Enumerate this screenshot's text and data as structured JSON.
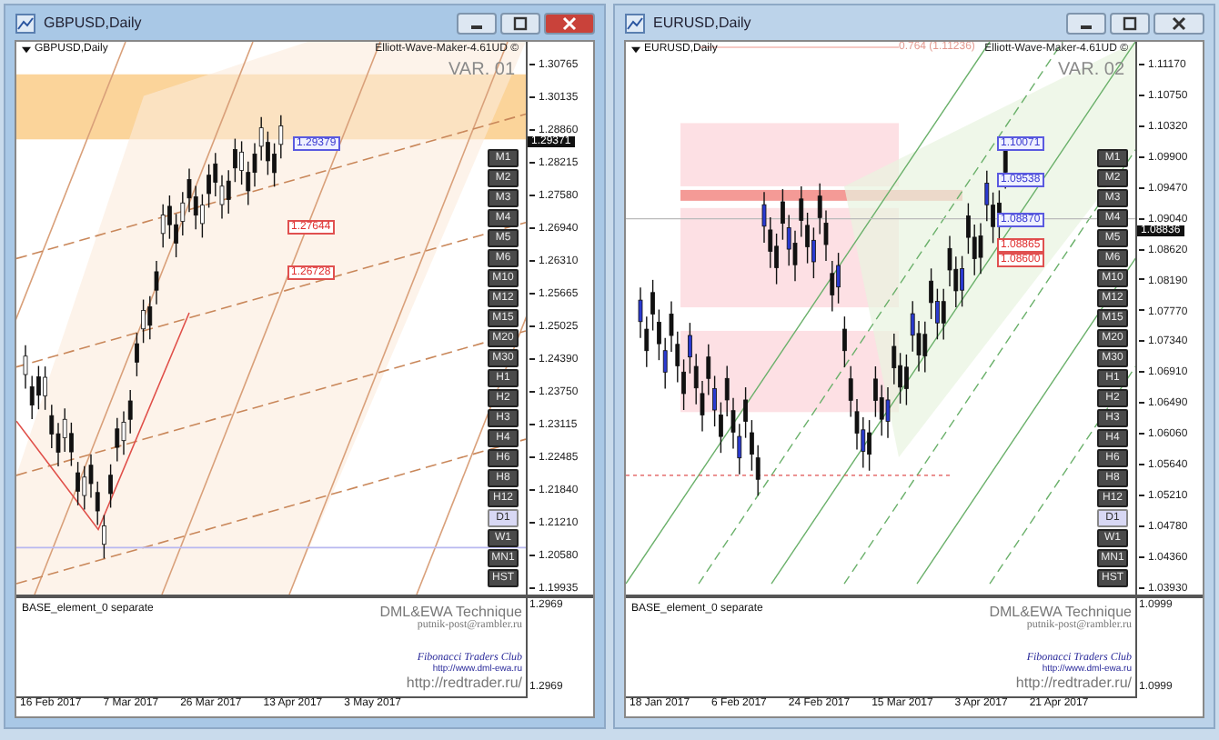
{
  "windows": [
    {
      "title": "GBPUSD,Daily",
      "active": true,
      "chart": {
        "symbol_label": "GBPUSD,Daily",
        "indicator": "Elliott-Wave-Maker-4.61UD ©",
        "variant": "VAR. 01",
        "price_labels": [
          {
            "text": "1.29379",
            "kind": "up"
          },
          {
            "text": "1.27644",
            "kind": "down"
          },
          {
            "text": "1.26728",
            "kind": "down"
          }
        ],
        "current_price": "1.29371",
        "price_ticks": [
          "1.30765",
          "1.30135",
          "1.28860",
          "1.28215",
          "1.27580",
          "1.26940",
          "1.26310",
          "1.25665",
          "1.25025",
          "1.24390",
          "1.23750",
          "1.23115",
          "1.22485",
          "1.21840",
          "1.21210",
          "1.20580",
          "1.19935"
        ],
        "timeframes": [
          {
            "label": "M1",
            "selected": false
          },
          {
            "label": "M2",
            "selected": false
          },
          {
            "label": "M3",
            "selected": false
          },
          {
            "label": "M4",
            "selected": false
          },
          {
            "label": "M5",
            "selected": false
          },
          {
            "label": "M6",
            "selected": false
          },
          {
            "label": "M10",
            "selected": false
          },
          {
            "label": "M12",
            "selected": false
          },
          {
            "label": "M15",
            "selected": false
          },
          {
            "label": "M20",
            "selected": false
          },
          {
            "label": "M30",
            "selected": false
          },
          {
            "label": "H1",
            "selected": false
          },
          {
            "label": "H2",
            "selected": false
          },
          {
            "label": "H3",
            "selected": false
          },
          {
            "label": "H4",
            "selected": false
          },
          {
            "label": "H6",
            "selected": false
          },
          {
            "label": "H8",
            "selected": false
          },
          {
            "label": "H12",
            "selected": false
          },
          {
            "label": "D1",
            "selected": true
          },
          {
            "label": "W1",
            "selected": false
          },
          {
            "label": "MN1",
            "selected": false
          },
          {
            "label": "HST",
            "selected": false
          }
        ]
      },
      "subpanel": {
        "label": "BASE_element_0 separate",
        "credits": [
          "DML&EWA Technique",
          "putnik-post@rambler.ru"
        ],
        "club": "Fibonacci Traders Club",
        "club_url": "http://www.dml-ewa.ru",
        "site": "http://redtrader.ru/",
        "ticks": [
          "1.2969",
          "1.2969"
        ]
      },
      "dates": [
        "16 Feb 2017",
        "7 Mar 2017",
        "26 Mar 2017",
        "13 Apr 2017",
        "3 May 2017"
      ]
    },
    {
      "title": "EURUSD,Daily",
      "active": false,
      "chart": {
        "symbol_label": "EURUSD,Daily",
        "indicator": "Elliott-Wave-Maker-4.61UD ©",
        "variant": "VAR. 02",
        "fib_note": "0.764 (1.11236)",
        "price_labels": [
          {
            "text": "1.10071",
            "kind": "up"
          },
          {
            "text": "1.09538",
            "kind": "up"
          },
          {
            "text": "1.08870",
            "kind": "up"
          },
          {
            "text": "1.08865",
            "kind": "down"
          },
          {
            "text": "1.08600",
            "kind": "down"
          }
        ],
        "current_price": "1.08836",
        "price_ticks": [
          "1.11170",
          "1.10750",
          "1.10320",
          "1.09900",
          "1.09470",
          "1.09040",
          "1.08620",
          "1.08190",
          "1.07770",
          "1.07340",
          "1.06910",
          "1.06490",
          "1.06060",
          "1.05640",
          "1.05210",
          "1.04780",
          "1.04360",
          "1.03930"
        ],
        "timeframes": [
          {
            "label": "M1",
            "selected": false
          },
          {
            "label": "M2",
            "selected": false
          },
          {
            "label": "M3",
            "selected": false
          },
          {
            "label": "M4",
            "selected": false
          },
          {
            "label": "M5",
            "selected": false
          },
          {
            "label": "M6",
            "selected": false
          },
          {
            "label": "M10",
            "selected": false
          },
          {
            "label": "M12",
            "selected": false
          },
          {
            "label": "M15",
            "selected": false
          },
          {
            "label": "M20",
            "selected": false
          },
          {
            "label": "M30",
            "selected": false
          },
          {
            "label": "H1",
            "selected": false
          },
          {
            "label": "H2",
            "selected": false
          },
          {
            "label": "H3",
            "selected": false
          },
          {
            "label": "H4",
            "selected": false
          },
          {
            "label": "H6",
            "selected": false
          },
          {
            "label": "H8",
            "selected": false
          },
          {
            "label": "H12",
            "selected": false
          },
          {
            "label": "D1",
            "selected": true
          },
          {
            "label": "W1",
            "selected": false
          },
          {
            "label": "MN1",
            "selected": false
          },
          {
            "label": "HST",
            "selected": false
          }
        ]
      },
      "subpanel": {
        "label": "BASE_element_0 separate",
        "credits": [
          "DML&EWA Technique",
          "putnik-post@rambler.ru"
        ],
        "club": "Fibonacci Traders Club",
        "club_url": "http://www.dml-ewa.ru",
        "site": "http://redtrader.ru/",
        "ticks": [
          "1.0999",
          "1.0999"
        ]
      },
      "dates": [
        "18 Jan 2017",
        "6 Feb 2017",
        "24 Feb 2017",
        "15 Mar 2017",
        "3 Apr 2017",
        "21 Apr 2017"
      ]
    }
  ]
}
